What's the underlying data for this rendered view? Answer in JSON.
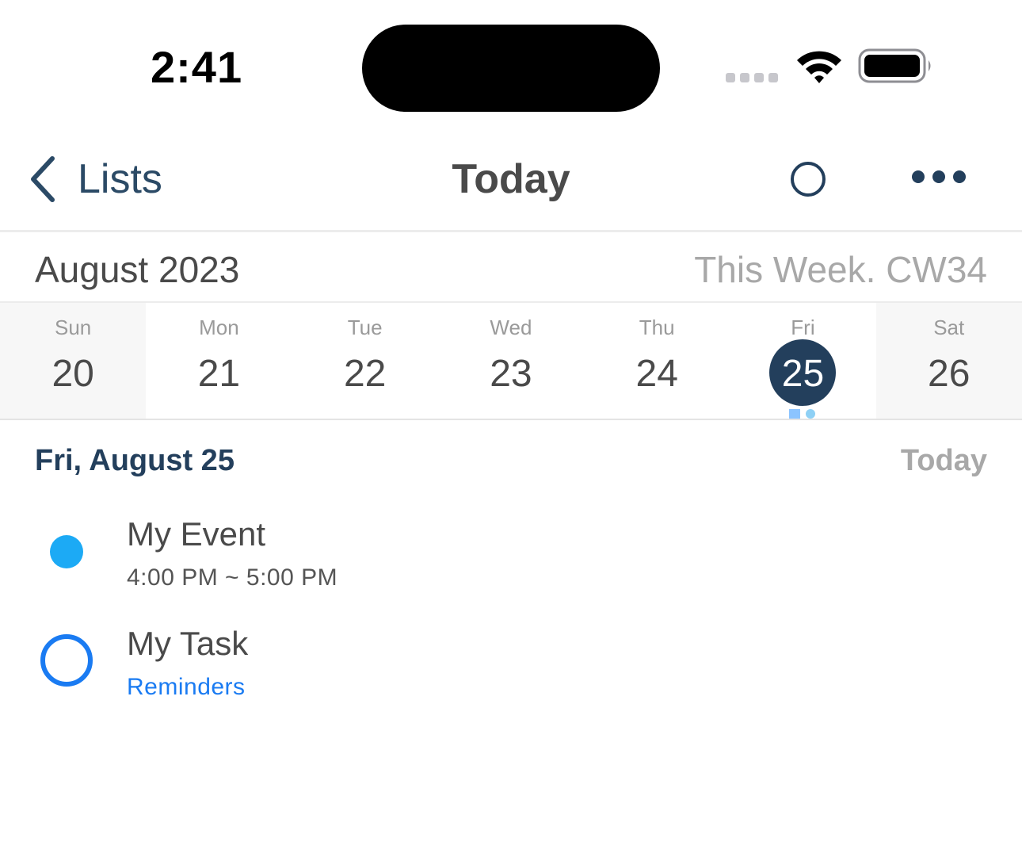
{
  "status_bar": {
    "time": "2:41"
  },
  "nav": {
    "back_label": "Lists",
    "title": "Today"
  },
  "calendar": {
    "month_title": "August 2023",
    "week_label": "This Week. CW34",
    "days": [
      {
        "name": "Sun",
        "num": "20"
      },
      {
        "name": "Mon",
        "num": "21"
      },
      {
        "name": "Tue",
        "num": "22"
      },
      {
        "name": "Wed",
        "num": "23"
      },
      {
        "name": "Thu",
        "num": "24"
      },
      {
        "name": "Fri",
        "num": "25"
      },
      {
        "name": "Sat",
        "num": "26"
      }
    ]
  },
  "agenda": {
    "date_heading": "Fri, August 25",
    "relative_label": "Today",
    "event": {
      "title": "My Event",
      "time": "4:00 PM ~ 5:00 PM"
    },
    "task": {
      "title": "My Task",
      "list": "Reminders"
    }
  },
  "colors": {
    "navy": "#233f5c",
    "event_blue": "#1caaf5",
    "task_blue": "#1a7bf2"
  }
}
